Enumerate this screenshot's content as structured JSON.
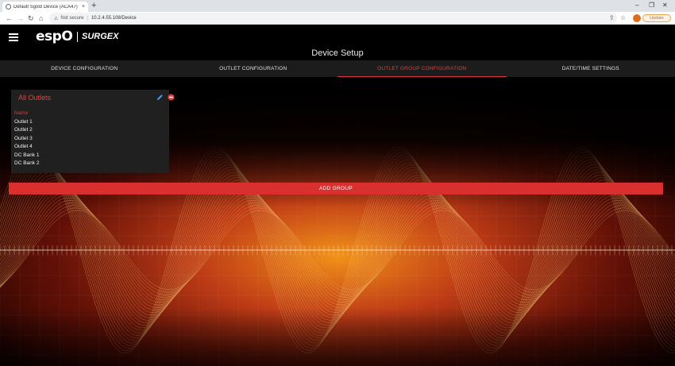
{
  "browser": {
    "tab_title": "Default Sgold Device (ACA47)",
    "tab_close": "×",
    "new_tab": "+",
    "address_security": "Not secure",
    "address_url": "10.2.4.55.108/Device",
    "update_label": "Update",
    "minimize": "–",
    "maximize": "❐",
    "close": "✕"
  },
  "header": {
    "logo_esp": "espO",
    "logo_surgex": "SURGEX",
    "title": "Device Setup"
  },
  "tabs": [
    {
      "label": "DEVICE CONFIGURATION",
      "active": false
    },
    {
      "label": "OUTLET CONFIGURATION",
      "active": false
    },
    {
      "label": "OUTLET GROUP CONFIGURATION",
      "active": true
    },
    {
      "label": "DATE/TIME SETTINGS",
      "active": false
    }
  ],
  "group": {
    "title": "All Outlets",
    "name_header": "Name",
    "outlets": [
      "Outlet 1",
      "Outlet 2",
      "Outlet 3",
      "Outlet 4",
      "DC Bank 1",
      "DC Bank 2"
    ]
  },
  "add_group_label": "ADD GROUP",
  "colors": {
    "accent": "#d92f2f",
    "card_bg": "#202020",
    "tab_bg": "#1c1c1c"
  }
}
